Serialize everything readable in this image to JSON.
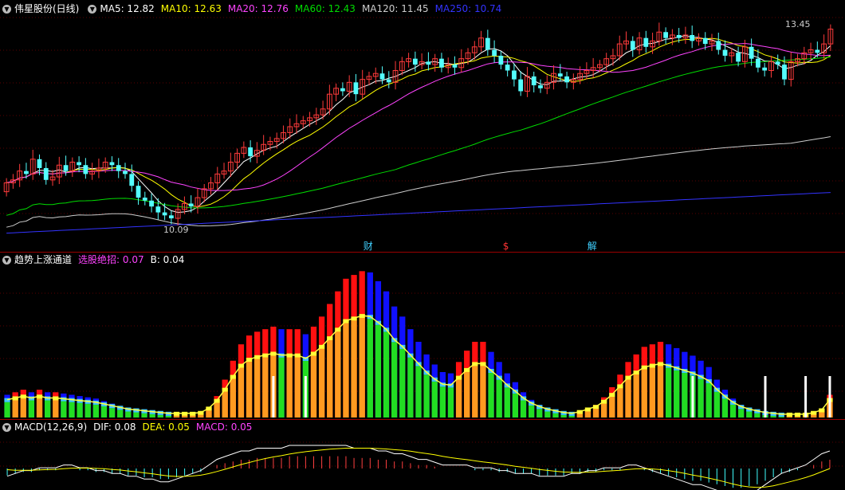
{
  "main_panel": {
    "title": "伟星股份(日线)",
    "indicators": [
      {
        "label": "MA5: 12.82",
        "color": "#ffffff"
      },
      {
        "label": "MA10: 12.63",
        "color": "#ffff00"
      },
      {
        "label": "MA20: 12.76",
        "color": "#ff44ff"
      },
      {
        "label": "MA60: 12.43",
        "color": "#00dd00"
      },
      {
        "label": "MA120: 11.45",
        "color": "#cccccc"
      },
      {
        "label": "MA250: 10.74",
        "color": "#3333ff"
      }
    ],
    "price_high_label": "13.45",
    "price_low_label": "10.09",
    "markers": [
      {
        "text": "财",
        "color": "#40d0ff",
        "pos": 0.43
      },
      {
        "text": "$",
        "color": "#ff3333",
        "pos": 0.595
      },
      {
        "text": "解",
        "color": "#40d0ff",
        "pos": 0.695
      }
    ]
  },
  "trend_panel": {
    "title": "趋势上涨通道",
    "indicators": [
      {
        "label": "选股绝招: 0.07",
        "color": "#ff44ff"
      },
      {
        "label": "B: 0.04",
        "color": "#ffffff"
      }
    ]
  },
  "macd_panel": {
    "title": "MACD(12,26,9)",
    "indicators": [
      {
        "label": "DIF: 0.08",
        "color": "#ffffff"
      },
      {
        "label": "DEA: 0.05",
        "color": "#ffff00"
      },
      {
        "label": "MACD: 0.05",
        "color": "#ff44ff"
      }
    ]
  },
  "chart_data": {
    "type": "candlestick",
    "title": "伟星股份(日线)",
    "ylim": [
      9.9,
      13.7
    ],
    "close": [
      10.85,
      10.9,
      11.05,
      11.0,
      11.25,
      11.1,
      10.9,
      10.95,
      11.15,
      11.05,
      11.2,
      11.15,
      11.0,
      11.05,
      11.1,
      11.2,
      11.15,
      11.05,
      11.0,
      10.8,
      10.6,
      10.55,
      10.45,
      10.35,
      10.3,
      10.25,
      10.4,
      10.5,
      10.45,
      10.6,
      10.75,
      10.85,
      11.0,
      11.05,
      11.2,
      11.35,
      11.45,
      11.3,
      11.4,
      11.5,
      11.55,
      11.6,
      11.7,
      11.8,
      11.85,
      11.9,
      11.95,
      12.0,
      12.1,
      12.35,
      12.45,
      12.4,
      12.55,
      12.35,
      12.6,
      12.65,
      12.7,
      12.6,
      12.55,
      12.75,
      12.9,
      12.95,
      12.85,
      12.9,
      12.85,
      12.95,
      12.8,
      12.85,
      12.8,
      12.95,
      13.05,
      13.15,
      13.3,
      13.1,
      13.0,
      12.85,
      12.75,
      12.6,
      12.4,
      12.65,
      12.5,
      12.45,
      12.55,
      12.7,
      12.65,
      12.55,
      12.6,
      12.7,
      12.75,
      12.8,
      12.85,
      12.95,
      13.0,
      13.2,
      13.25,
      13.1,
      13.3,
      13.15,
      13.25,
      13.4,
      13.3,
      13.35,
      13.3,
      13.35,
      13.25,
      13.3,
      13.2,
      13.25,
      13.1,
      13.0,
      13.05,
      12.9,
      13.15,
      12.95,
      12.8,
      12.75,
      12.9,
      12.85,
      12.6,
      12.9,
      12.95,
      13.05,
      13.1,
      13.05,
      13.2,
      13.45
    ],
    "open": [
      10.7,
      10.85,
      10.9,
      11.05,
      11.0,
      11.25,
      11.1,
      10.9,
      10.95,
      11.15,
      11.05,
      11.2,
      11.15,
      11.0,
      11.05,
      11.1,
      11.2,
      11.15,
      11.05,
      11.0,
      10.8,
      10.6,
      10.55,
      10.45,
      10.35,
      10.3,
      10.25,
      10.4,
      10.5,
      10.45,
      10.6,
      10.75,
      10.85,
      11.0,
      11.05,
      11.2,
      11.35,
      11.45,
      11.3,
      11.4,
      11.5,
      11.55,
      11.6,
      11.7,
      11.8,
      11.85,
      11.9,
      11.95,
      12.0,
      12.1,
      12.35,
      12.45,
      12.4,
      12.55,
      12.35,
      12.6,
      12.65,
      12.7,
      12.6,
      12.55,
      12.75,
      12.9,
      12.95,
      12.85,
      12.9,
      12.85,
      12.95,
      12.8,
      12.85,
      12.8,
      12.95,
      13.05,
      13.15,
      13.3,
      13.1,
      13.0,
      12.85,
      12.75,
      12.6,
      12.4,
      12.65,
      12.5,
      12.45,
      12.55,
      12.7,
      12.65,
      12.55,
      12.6,
      12.7,
      12.75,
      12.8,
      12.85,
      12.95,
      13.0,
      13.2,
      13.25,
      13.1,
      13.3,
      13.15,
      13.25,
      13.4,
      13.3,
      13.35,
      13.3,
      13.35,
      13.25,
      13.3,
      13.2,
      13.25,
      13.1,
      13.0,
      13.05,
      12.9,
      13.15,
      12.95,
      12.8,
      12.75,
      12.9,
      12.85,
      12.6,
      12.9,
      12.95,
      13.05,
      13.1,
      13.05,
      13.2
    ],
    "trend": [
      0.18,
      0.2,
      0.22,
      0.2,
      0.22,
      0.2,
      0.2,
      0.19,
      0.18,
      0.17,
      0.16,
      0.15,
      0.13,
      0.11,
      0.09,
      0.07,
      0.06,
      0.05,
      0.04,
      0.03,
      0.02,
      0.02,
      0.02,
      0.02,
      0.03,
      0.08,
      0.17,
      0.3,
      0.45,
      0.58,
      0.65,
      0.68,
      0.7,
      0.72,
      0.7,
      0.7,
      0.7,
      0.66,
      0.72,
      0.8,
      0.9,
      1.0,
      1.1,
      1.13,
      1.16,
      1.15,
      1.08,
      1.0,
      0.88,
      0.8,
      0.7,
      0.6,
      0.5,
      0.42,
      0.36,
      0.35,
      0.44,
      0.53,
      0.6,
      0.6,
      0.52,
      0.44,
      0.35,
      0.28,
      0.2,
      0.14,
      0.1,
      0.07,
      0.05,
      0.03,
      0.02,
      0.04,
      0.07,
      0.1,
      0.16,
      0.24,
      0.34,
      0.44,
      0.5,
      0.56,
      0.58,
      0.6,
      0.58,
      0.55,
      0.52,
      0.49,
      0.45,
      0.4,
      0.3,
      0.22,
      0.15,
      0.1,
      0.07,
      0.05,
      0.03,
      0.02,
      0.01,
      0.01,
      0.01,
      0.01,
      0.03,
      0.06,
      0.18
    ],
    "macd_hist": [
      -0.04,
      -0.03,
      -0.02,
      -0.02,
      -0.01,
      -0.01,
      -0.01,
      0.0,
      0.0,
      -0.01,
      -0.01,
      -0.02,
      -0.02,
      -0.03,
      -0.03,
      -0.04,
      -0.04,
      -0.05,
      -0.05,
      -0.06,
      -0.06,
      -0.05,
      -0.04,
      -0.03,
      -0.02,
      0.0,
      0.02,
      0.03,
      0.04,
      0.05,
      0.05,
      0.06,
      0.06,
      0.06,
      0.06,
      0.07,
      0.07,
      0.07,
      0.07,
      0.07,
      0.07,
      0.07,
      0.07,
      0.06,
      0.06,
      0.06,
      0.05,
      0.05,
      0.04,
      0.04,
      0.03,
      0.02,
      0.02,
      0.01,
      0.0,
      0.0,
      0.0,
      0.0,
      -0.01,
      -0.01,
      -0.01,
      -0.02,
      -0.02,
      -0.03,
      -0.03,
      -0.03,
      -0.04,
      -0.04,
      -0.04,
      -0.04,
      -0.03,
      -0.03,
      -0.02,
      -0.02,
      -0.01,
      -0.01,
      -0.01,
      0.0,
      0.0,
      -0.01,
      -0.02,
      -0.03,
      -0.04,
      -0.05,
      -0.06,
      -0.07,
      -0.07,
      -0.08,
      -0.09,
      -0.1,
      -0.11,
      -0.11,
      -0.1,
      -0.09,
      -0.07,
      -0.05,
      -0.03,
      -0.02,
      -0.01,
      0.0,
      0.02,
      0.04,
      0.05
    ]
  }
}
